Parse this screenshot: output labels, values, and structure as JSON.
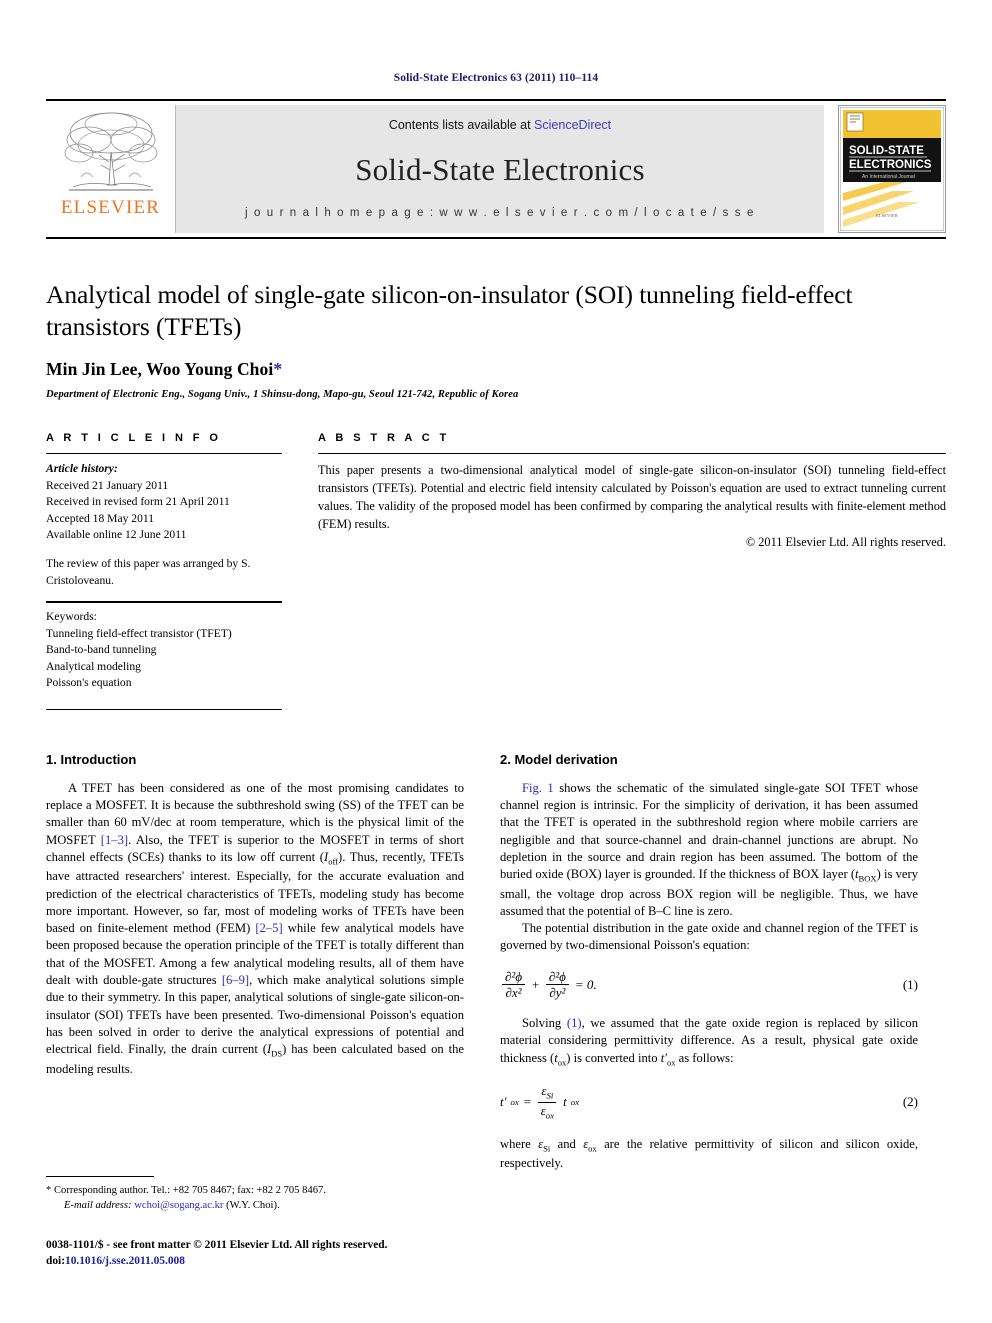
{
  "running_head": "Solid-State Electronics 63 (2011) 110–114",
  "masthead": {
    "publisher_name": "ELSEVIER",
    "contents_prefix": "Contents lists available at ",
    "sciencedirect": "ScienceDirect",
    "journal_title": "Solid-State Electronics",
    "homepage": "j o u r n a l   h o m e p a g e :   w w w . e l s e v i e r . c o m / l o c a t e / s s e",
    "cover": {
      "line1": "SOLID-STATE",
      "line2": "ELECTRONICS",
      "subtitle": "An International Journal",
      "footer": "ELSEVIER"
    }
  },
  "article": {
    "title": "Analytical model of single-gate silicon-on-insulator (SOI) tunneling field-effect transistors (TFETs)",
    "authors": "Min Jin Lee, Woo Young Choi",
    "corresponding_marker": "*",
    "affiliation": "Department of Electronic Eng., Sogang Univ., 1 Shinsu-dong, Mapo-gu, Seoul 121-742, Republic of Korea"
  },
  "article_info": {
    "heading": "A R T I C L E   I N F O",
    "history_label": "Article history:",
    "history": [
      "Received 21 January 2011",
      "Received in revised form 21 April 2011",
      "Accepted 18 May 2011",
      "Available online 12 June 2011"
    ],
    "editor_note": "The review of this paper was arranged by S. Cristoloveanu.",
    "keywords_label": "Keywords:",
    "keywords": [
      "Tunneling field-effect transistor (TFET)",
      "Band-to-band tunneling",
      "Analytical modeling",
      "Poisson's equation"
    ]
  },
  "abstract": {
    "heading": "A B S T R A C T",
    "text": "This paper presents a two-dimensional analytical model of single-gate silicon-on-insulator (SOI) tunneling field-effect transistors (TFETs). Potential and electric field intensity calculated by Poisson's equation are used to extract tunneling current values. The validity of the proposed model has been confirmed by comparing the analytical results with finite-element method (FEM) results.",
    "copyright": "© 2011 Elsevier Ltd. All rights reserved."
  },
  "section1": {
    "title": "1. Introduction",
    "p1_a": "A TFET has been considered as one of the most promising candidates to replace a MOSFET. It is because the subthreshold swing (SS) of the TFET can be smaller than 60 mV/dec at room temperature, which is the physical limit of the MOSFET ",
    "p1_cite1": "[1–3]",
    "p1_b": ". Also, the TFET is superior to the MOSFET in terms of short channel effects (SCEs) thanks to its low off current (",
    "p1_ioff": "I",
    "p1_ioff_sub": "off",
    "p1_c": "). Thus, recently, TFETs have attracted researchers' interest. Especially, for the accurate evaluation and prediction of the electrical characteristics of TFETs, modeling study has become more important. However, so far, most of modeling works of TFETs have been based on finite-element method (FEM) ",
    "p1_cite2": "[2–5]",
    "p1_d": " while few analytical models have been proposed because the operation principle of the TFET is totally different than that of the MOSFET. Among a few analytical modeling results, all of them have dealt with double-gate structures ",
    "p1_cite3": "[6–9]",
    "p1_e": ", which make analytical solutions simple due to their symmetry. In this paper, analytical solutions of single-gate silicon-on-insulator (SOI) TFETs have been presented. Two-dimensional Poisson's equation has been solved in order to derive the analytical expressions of potential and electrical field. Finally, the drain current (",
    "p1_ids": "I",
    "p1_ids_sub": "DS",
    "p1_f": ") has been calculated based on the modeling results."
  },
  "section2": {
    "title": "2. Model derivation",
    "p1_figref": "Fig. 1",
    "p1_a": " shows the schematic of the simulated single-gate SOI TFET whose channel region is intrinsic. For the simplicity of derivation, it has been assumed that the TFET is operated in the subthreshold region where mobile carriers are negligible and that source-channel and drain-channel junctions are abrupt. No depletion in the source and drain region has been assumed. The bottom of the buried oxide (BOX) layer is grounded. If the thickness of BOX layer (",
    "p1_tbox": "t",
    "p1_tbox_sub": "BOX",
    "p1_b": ") is very small, the voltage drop across BOX region will be negligible. Thus, we have assumed that the potential of B–C line is zero.",
    "p2": "The potential distribution in the gate oxide and channel region of the TFET is governed by two-dimensional Poisson's equation:",
    "eq1": {
      "num1": "∂²ϕ",
      "den1": "∂x²",
      "plus": "+",
      "num2": "∂²ϕ",
      "den2": "∂y²",
      "rhs": "= 0.",
      "number": "(1)"
    },
    "p3_a": "Solving ",
    "p3_ref": "(1)",
    "p3_b": ", we assumed that the gate oxide region is replaced by silicon material considering permittivity difference. As a result, physical gate oxide thickness (",
    "p3_tox": "t",
    "p3_tox_sub": "ox",
    "p3_c": ") is converted into ",
    "p3_toxp": "t′",
    "p3_toxp_sub": "ox",
    "p3_d": " as follows:",
    "eq2": {
      "lhs": "t′",
      "lhs_sub": "ox",
      "eq": "=",
      "num": "ε",
      "num_sub": "Si",
      "den": "ε",
      "den_sub": "ox",
      "tail": "t",
      "tail_sub": "ox",
      "number": "(2)"
    },
    "p4_a": "where ",
    "p4_eps1": "ε",
    "p4_eps1_sub": "Si",
    "p4_b": " and ",
    "p4_eps2": "ε",
    "p4_eps2_sub": "ox",
    "p4_c": " are the relative permittivity of silicon and silicon oxide, respectively."
  },
  "footnote": {
    "marker": "*",
    "corresponding": "Corresponding author. Tel.: +82 705 8467; fax: +82 2 705 8467.",
    "email_label": "E-mail address:",
    "email": "wchoi@sogang.ac.kr",
    "email_owner": "(W.Y. Choi)."
  },
  "imprint": {
    "line1": "0038-1101/$ - see front matter © 2011 Elsevier Ltd. All rights reserved.",
    "doi_label": "doi:",
    "doi": "10.1016/j.sse.2011.05.008"
  },
  "colors": {
    "link": "#2b2bbb",
    "elsevier_orange": "#E87722",
    "running_head": "#1a1a6e",
    "band_bg": "#e6e6e6",
    "cover_yellow": "#F2C230"
  }
}
